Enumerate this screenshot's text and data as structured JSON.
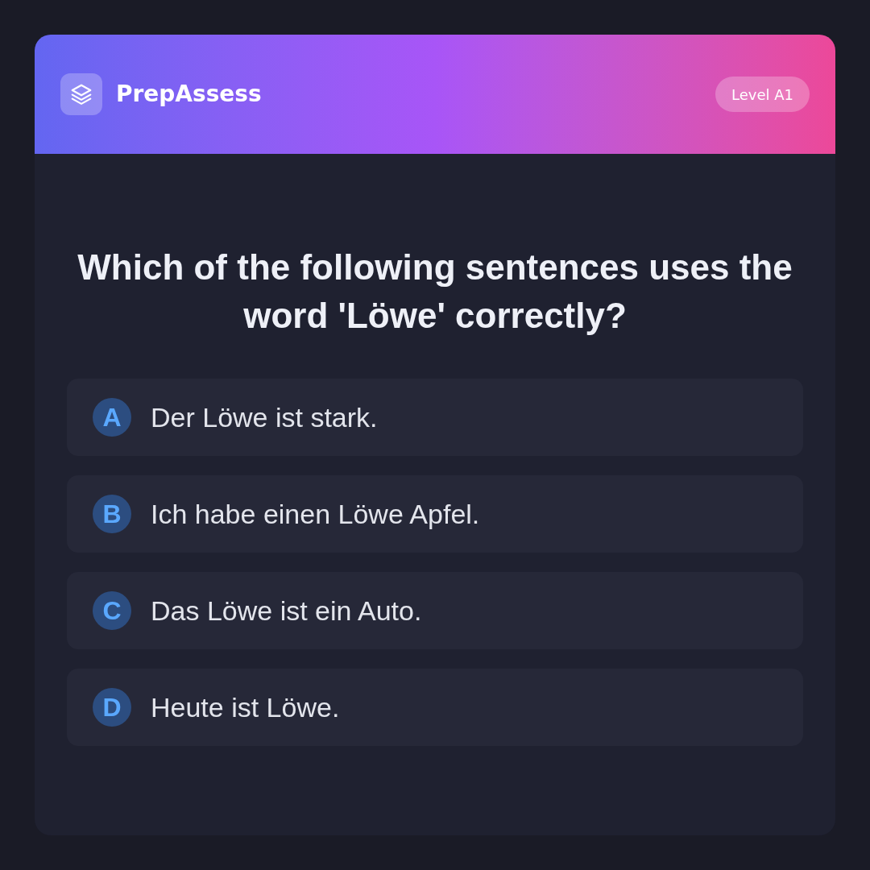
{
  "header": {
    "app_name": "PrepAssess",
    "level": "Level A1"
  },
  "question": "Which of the following sentences uses the word 'Löwe' correctly?",
  "options": [
    {
      "letter": "A",
      "text": "Der Löwe ist stark.",
      "selected": false
    },
    {
      "letter": "B",
      "text": "Ich habe einen Löwe Apfel.",
      "selected": false
    },
    {
      "letter": "C",
      "text": "Das Löwe ist ein Auto.",
      "selected": false
    },
    {
      "letter": "D",
      "text": "Heute ist Löwe.",
      "selected": false
    }
  ]
}
